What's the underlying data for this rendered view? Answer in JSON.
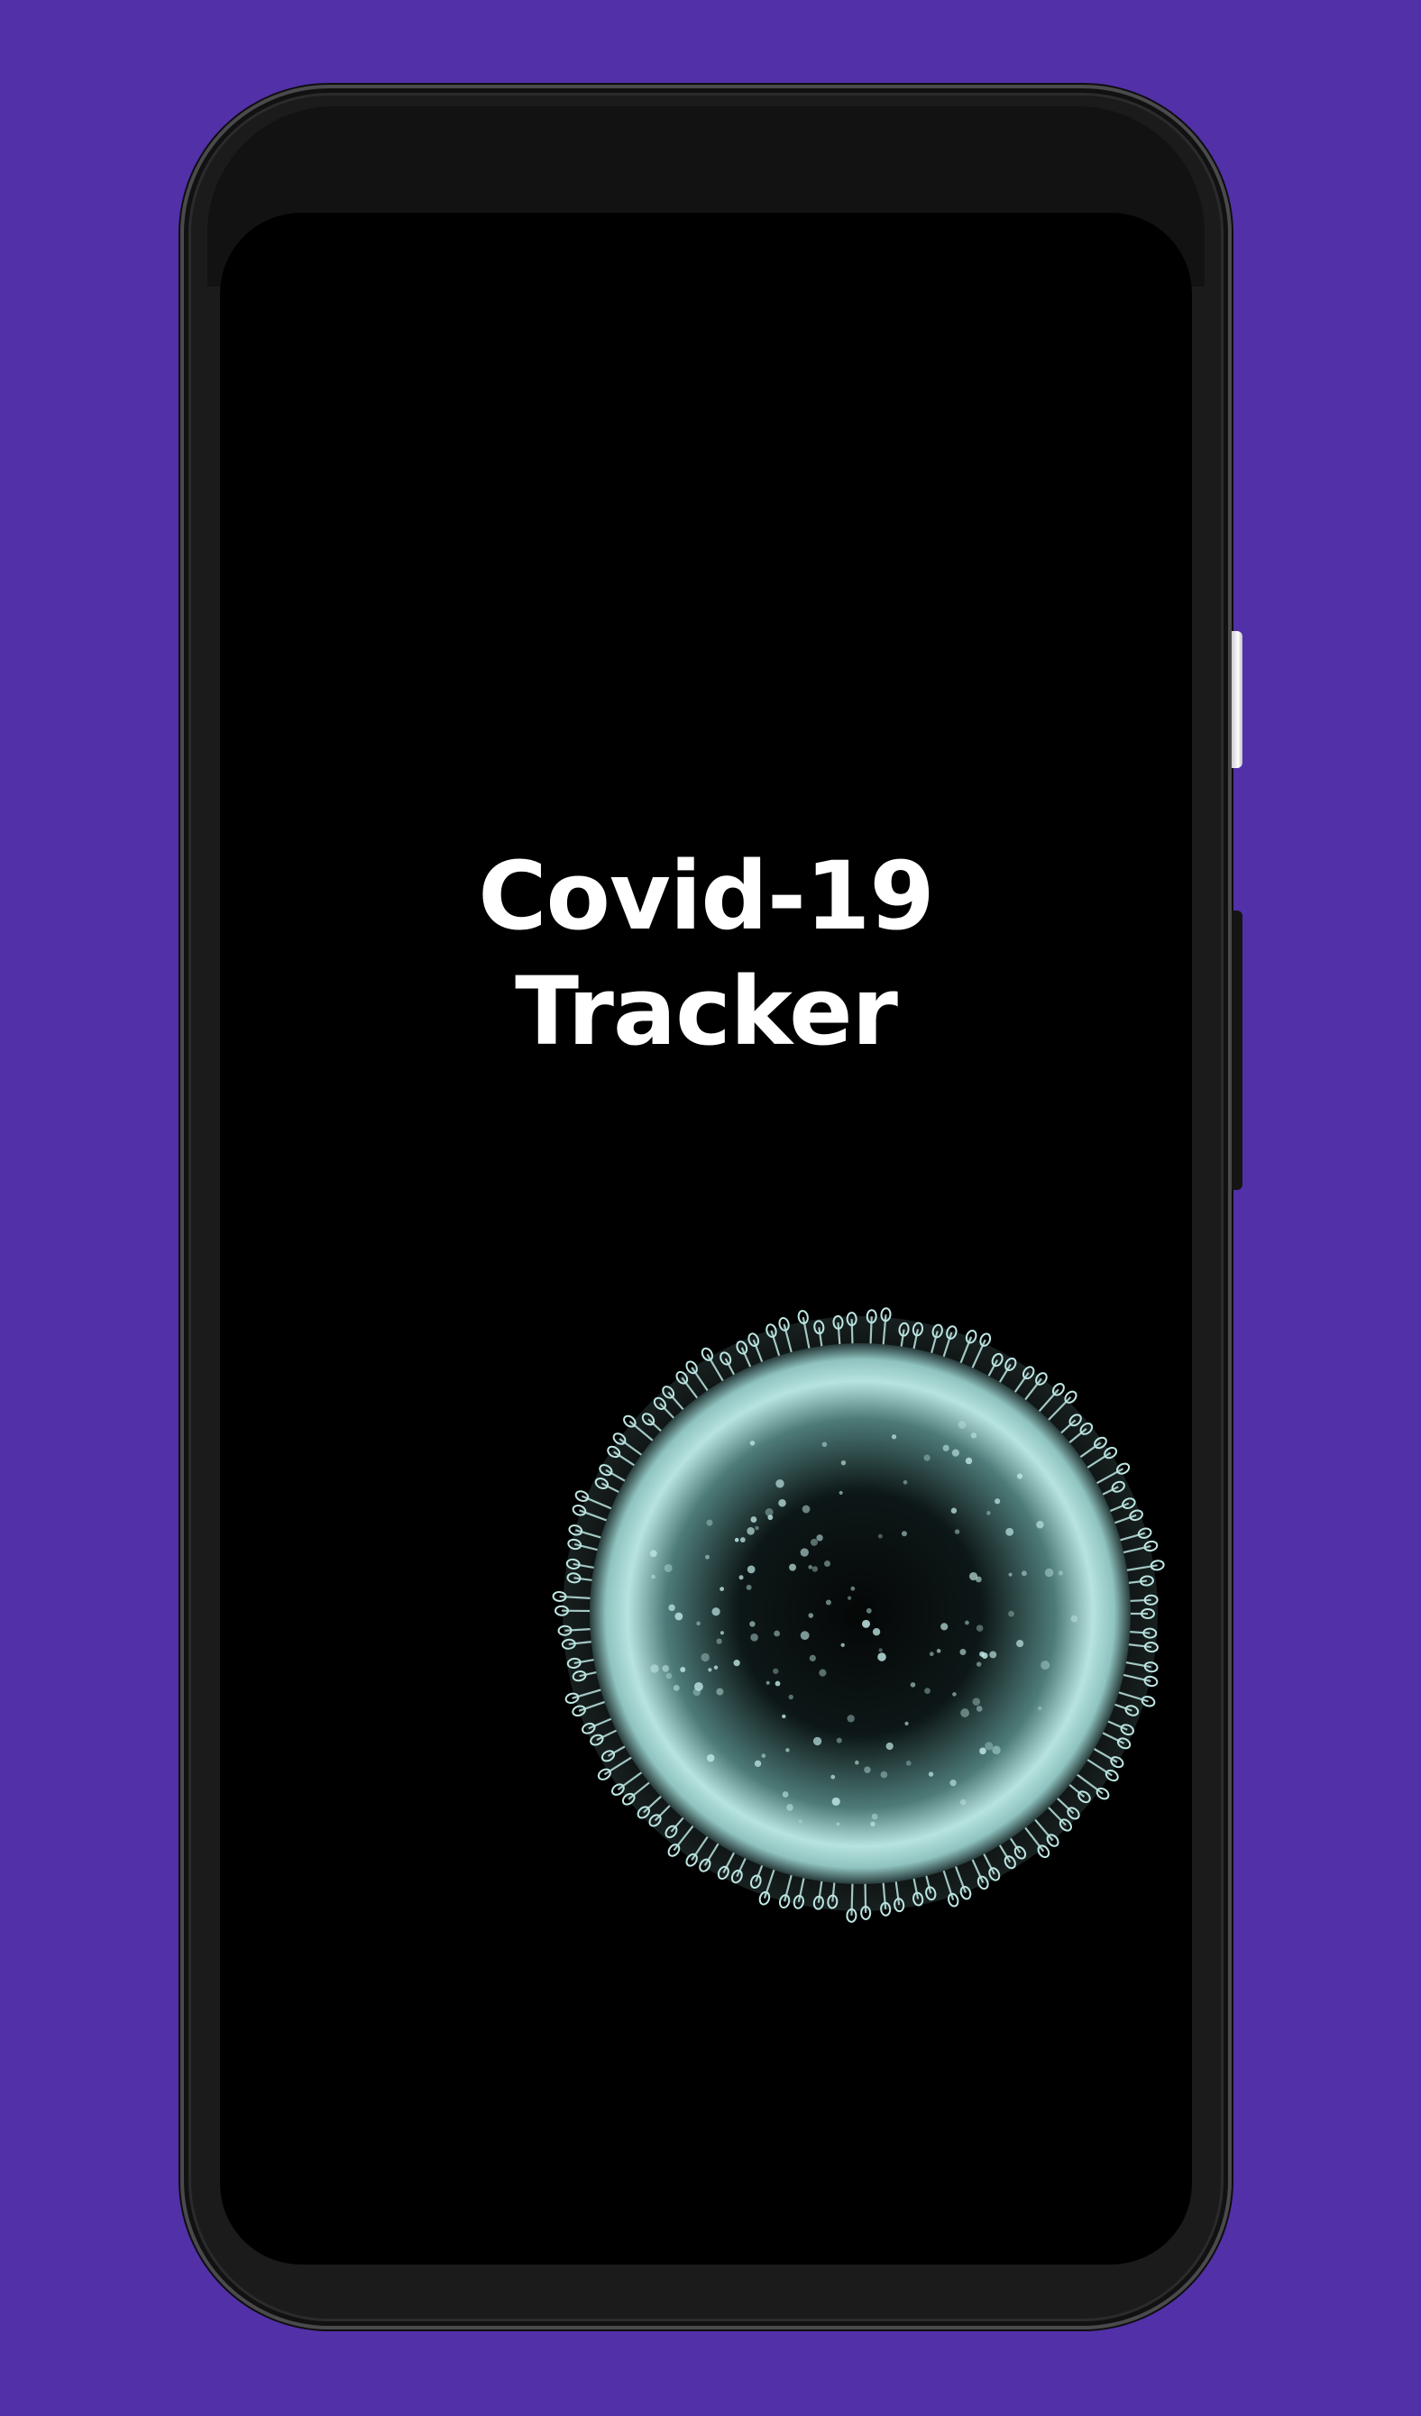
{
  "app": {
    "title_line1": "Covid-19",
    "title_line2": "Tracker"
  },
  "colors": {
    "background": "#5230A8",
    "screen": "#000000",
    "title": "#FFFFFF",
    "virus": "#BFE7E4"
  },
  "icons": {
    "illustration": "coronavirus-illustration"
  }
}
